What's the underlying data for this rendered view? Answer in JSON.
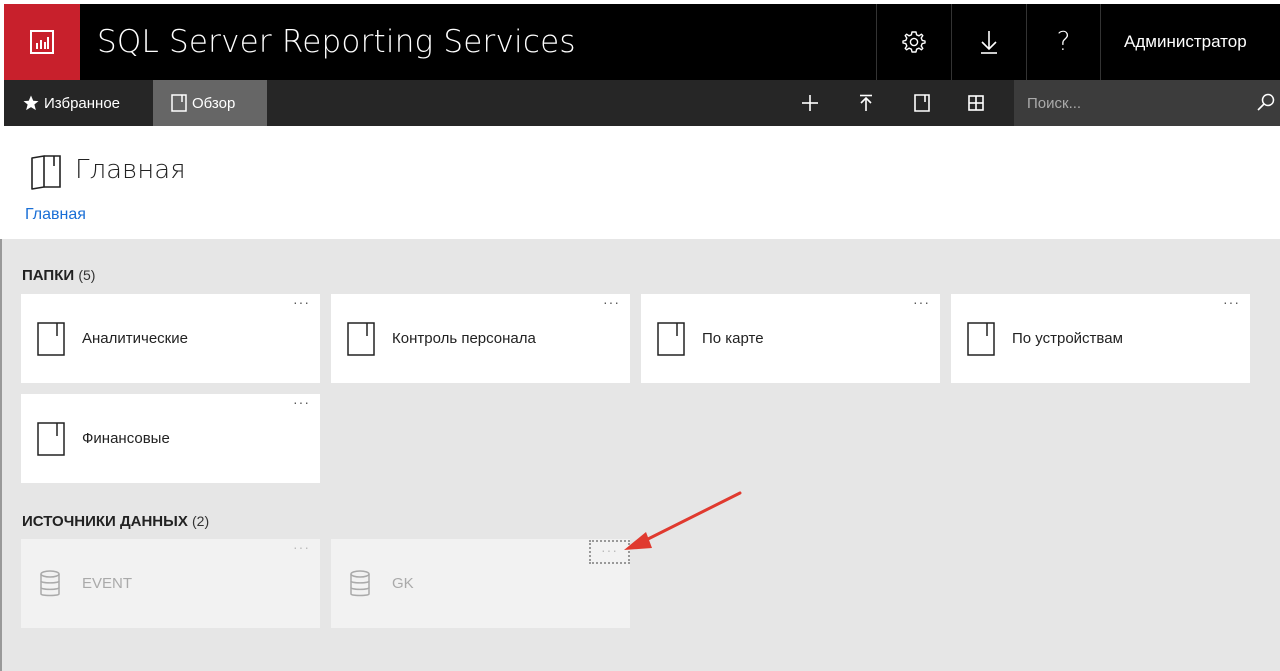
{
  "header": {
    "app_title": "SQL Server Reporting Services",
    "settings_icon": "gear-icon",
    "download_icon": "download-icon",
    "help_label": "?",
    "user_label": "Администратор"
  },
  "nav": {
    "favorites_label": "Избранное",
    "browse_label": "Обзор",
    "search_placeholder": "Поиск..."
  },
  "page": {
    "title": "Главная",
    "breadcrumb": "Главная"
  },
  "folders": {
    "title": "ПАПКИ",
    "count": "(5)",
    "items": [
      {
        "label": "Аналитические",
        "more": "···"
      },
      {
        "label": "Контроль персонала",
        "more": "···"
      },
      {
        "label": "По карте",
        "more": "···"
      },
      {
        "label": "По устройствам",
        "more": "···"
      },
      {
        "label": "Финансовые",
        "more": "···"
      }
    ]
  },
  "datasources": {
    "title": "ИСТОЧНИКИ ДАННЫХ",
    "count": "(2)",
    "items": [
      {
        "label": "EVENT",
        "more": "···"
      },
      {
        "label": "GK",
        "more": "···"
      }
    ]
  },
  "colors": {
    "brand": "#c8202c",
    "topbar": "#000000",
    "subnav": "#262626",
    "active_tab": "#666666",
    "link": "#1a6fd6",
    "annotation_arrow": "#e03a2f"
  }
}
